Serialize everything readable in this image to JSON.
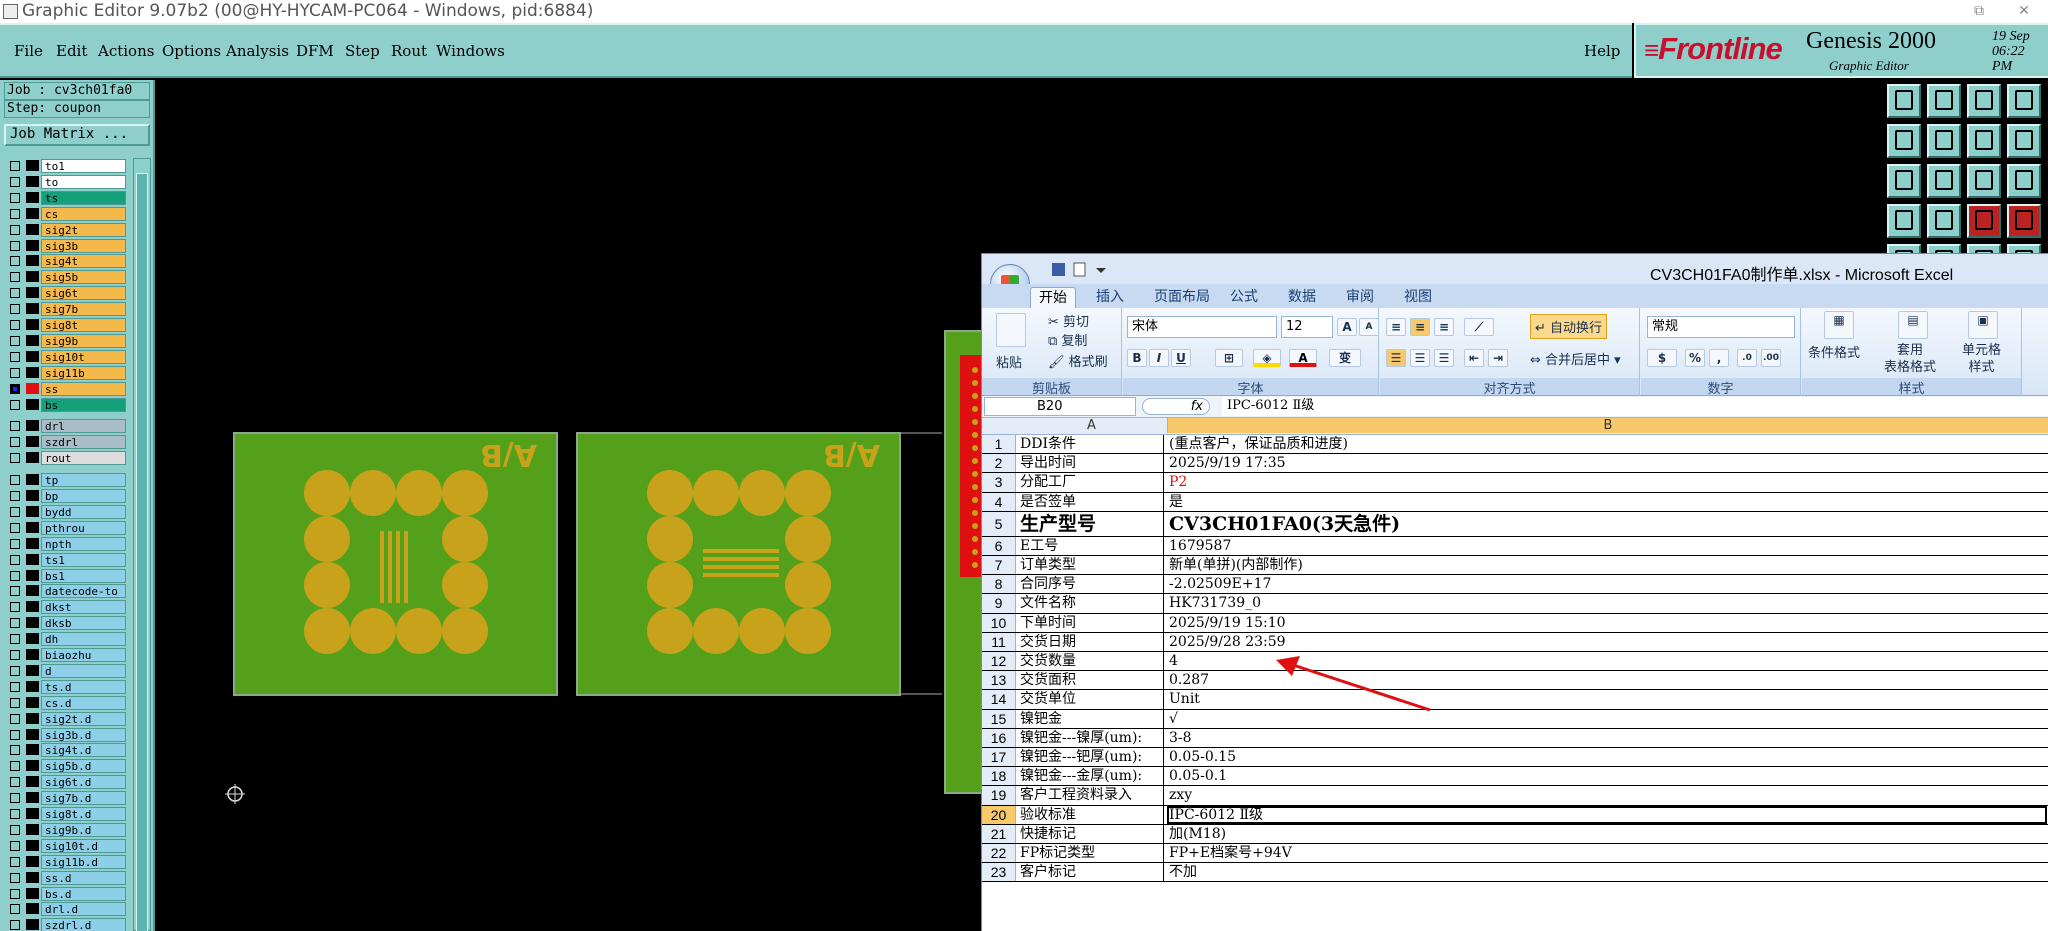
{
  "window": {
    "title": "Graphic Editor 9.07b2 (00@HY-HYCAM-PC064 - Windows, pid:6884)",
    "restore_glyph": "⧉",
    "close_glyph": "✕"
  },
  "menu": {
    "items": [
      "File",
      "Edit",
      "Actions",
      "Options",
      "Analysis",
      "DFM",
      "Step",
      "Rout",
      "Windows"
    ],
    "help": "Help"
  },
  "brand": {
    "logo": "Frontline",
    "product": "Genesis 2000",
    "subtitle": "Graphic Editor",
    "date": "19 Sep",
    "time": "06:22 PM"
  },
  "job": {
    "job_line": "Job : cv3ch01fa0",
    "step_line": "Step: coupon",
    "matrix_button": "Job Matrix ..."
  },
  "layers": [
    {
      "name": "to1",
      "color": "#ffffff",
      "checked": false
    },
    {
      "name": "to",
      "color": "#ffffff",
      "checked": false
    },
    {
      "name": "ts",
      "color": "#13a07a",
      "checked": false
    },
    {
      "name": "cs",
      "color": "#f5b84a",
      "checked": false
    },
    {
      "name": "sig2t",
      "color": "#f5b84a",
      "checked": false
    },
    {
      "name": "sig3b",
      "color": "#f5b84a",
      "checked": false
    },
    {
      "name": "sig4t",
      "color": "#f5b84a",
      "checked": false
    },
    {
      "name": "sig5b",
      "color": "#f5b84a",
      "checked": false
    },
    {
      "name": "sig6t",
      "color": "#f5b84a",
      "checked": false
    },
    {
      "name": "sig7b",
      "color": "#f5b84a",
      "checked": false
    },
    {
      "name": "sig8t",
      "color": "#f5b84a",
      "checked": false
    },
    {
      "name": "sig9b",
      "color": "#f5b84a",
      "checked": false
    },
    {
      "name": "sig10t",
      "color": "#f5b84a",
      "checked": false
    },
    {
      "name": "sig11b",
      "color": "#f5b84a",
      "checked": false
    },
    {
      "name": "ss",
      "color": "#f5b84a",
      "checked": true,
      "swatch": "#e01010"
    },
    {
      "name": "bs",
      "color": "#13a07a",
      "checked": false
    },
    {
      "name": "drl",
      "color": "#a8bdc8",
      "checked": false
    },
    {
      "name": "szdrl",
      "color": "#a8bdc8",
      "checked": false
    },
    {
      "name": "rout",
      "color": "#dddddd",
      "checked": false
    },
    {
      "name": "tp",
      "color": "#8ecfe8",
      "checked": false
    },
    {
      "name": "bp",
      "color": "#8ecfe8",
      "checked": false
    },
    {
      "name": "bydd",
      "color": "#8ecfe8",
      "checked": false
    },
    {
      "name": "pthrou",
      "color": "#8ecfe8",
      "checked": false
    },
    {
      "name": "npth",
      "color": "#8ecfe8",
      "checked": false
    },
    {
      "name": "ts1",
      "color": "#8ecfe8",
      "checked": false
    },
    {
      "name": "bs1",
      "color": "#8ecfe8",
      "checked": false
    },
    {
      "name": "datecode-to",
      "color": "#8ecfe8",
      "checked": false
    },
    {
      "name": "dkst",
      "color": "#8ecfe8",
      "checked": false
    },
    {
      "name": "dksb",
      "color": "#8ecfe8",
      "checked": false
    },
    {
      "name": "dh",
      "color": "#8ecfe8",
      "checked": false
    },
    {
      "name": "biaozhu",
      "color": "#8ecfe8",
      "checked": false
    },
    {
      "name": "d",
      "color": "#8ecfe8",
      "checked": false
    },
    {
      "name": "ts.d",
      "color": "#8ecfe8",
      "checked": false
    },
    {
      "name": "cs.d",
      "color": "#8ecfe8",
      "checked": false
    },
    {
      "name": "sig2t.d",
      "color": "#8ecfe8",
      "checked": false
    },
    {
      "name": "sig3b.d",
      "color": "#8ecfe8",
      "checked": false
    },
    {
      "name": "sig4t.d",
      "color": "#8ecfe8",
      "checked": false
    },
    {
      "name": "sig5b.d",
      "color": "#8ecfe8",
      "checked": false
    },
    {
      "name": "sig6t.d",
      "color": "#8ecfe8",
      "checked": false
    },
    {
      "name": "sig7b.d",
      "color": "#8ecfe8",
      "checked": false
    },
    {
      "name": "sig8t.d",
      "color": "#8ecfe8",
      "checked": false
    },
    {
      "name": "sig9b.d",
      "color": "#8ecfe8",
      "checked": false
    },
    {
      "name": "sig10t.d",
      "color": "#8ecfe8",
      "checked": false
    },
    {
      "name": "sig11b.d",
      "color": "#8ecfe8",
      "checked": false
    },
    {
      "name": "ss.d",
      "color": "#8ecfe8",
      "checked": false
    },
    {
      "name": "bs.d",
      "color": "#8ecfe8",
      "checked": false
    },
    {
      "name": "drl.d",
      "color": "#8ecfe8",
      "checked": false
    },
    {
      "name": "szdrl.d",
      "color": "#8ecfe8",
      "checked": false
    }
  ],
  "canvas": {
    "board_marking": "A/B",
    "board_color": "#55a01a",
    "pad_color": "#c9a21c"
  },
  "excel": {
    "title": "CV3CH01FA0制作单.xlsx - Microsoft Excel",
    "tabs": [
      "开始",
      "插入",
      "页面布局",
      "公式",
      "数据",
      "审阅",
      "视图"
    ],
    "clipboard": {
      "paste": "粘贴",
      "cut": "剪切",
      "copy": "复制",
      "format_painter": "格式刷",
      "label": "剪贴板"
    },
    "font": {
      "name": "宋体",
      "size": "12",
      "label": "字体",
      "bold": "B",
      "italic": "I",
      "underline": "U",
      "grow": "A",
      "shrink": "A"
    },
    "alignment": {
      "wrap": "自动换行",
      "merge": "合并后居中",
      "label": "对齐方式"
    },
    "number": {
      "format": "常规",
      "percent": "%",
      "comma": ",",
      "label": "数字"
    },
    "styles": {
      "conditional": "条件格式",
      "table": "套用\n表格格式",
      "cell": "单元格\n样式",
      "label": "样式"
    },
    "name_box": "B20",
    "fx": "fx",
    "formula": "IPC-6012 Ⅱ级",
    "columns": [
      "A",
      "B"
    ],
    "rows": [
      {
        "n": "1",
        "a": "DDI条件",
        "b": "(重点客户，保证品质和进度)"
      },
      {
        "n": "2",
        "a": "导出时间",
        "b": "2025/9/19 17:35"
      },
      {
        "n": "3",
        "a": "分配工厂",
        "b": "P2",
        "red": true
      },
      {
        "n": "4",
        "a": "是否签单",
        "b": "是"
      },
      {
        "n": "5",
        "a": "生产型号",
        "b": "CV3CH01FA0(3天急件)",
        "big": true
      },
      {
        "n": "6",
        "a": "E工号",
        "b": "1679587"
      },
      {
        "n": "7",
        "a": "订单类型",
        "b": "新单(单拼)(内部制作)"
      },
      {
        "n": "8",
        "a": "合同序号",
        "b": "-2.02509E+17"
      },
      {
        "n": "9",
        "a": "文件名称",
        "b": "HK731739_0"
      },
      {
        "n": "10",
        "a": "下单时间",
        "b": "2025/9/19 15:10"
      },
      {
        "n": "11",
        "a": "交货日期",
        "b": "2025/9/28 23:59"
      },
      {
        "n": "12",
        "a": "交货数量",
        "b": "4"
      },
      {
        "n": "13",
        "a": "交货面积",
        "b": "0.287"
      },
      {
        "n": "14",
        "a": "交货单位",
        "b": "Unit"
      },
      {
        "n": "15",
        "a": "镍钯金",
        "b": "√"
      },
      {
        "n": "16",
        "a": "镍钯金---镍厚(um):",
        "b": "3-8"
      },
      {
        "n": "17",
        "a": "镍钯金---钯厚(um):",
        "b": "0.05-0.15"
      },
      {
        "n": "18",
        "a": "镍钯金---金厚(um):",
        "b": "0.05-0.1"
      },
      {
        "n": "19",
        "a": "客户工程资料录入",
        "b": "zxy"
      },
      {
        "n": "20",
        "a": "验收标准",
        "b": "IPC-6012 Ⅱ级",
        "selected": true
      },
      {
        "n": "21",
        "a": "快捷标记",
        "b": "加(M18)"
      },
      {
        "n": "22",
        "a": "FP标记类型",
        "b": "FP+E档案号+94V"
      },
      {
        "n": "23",
        "a": "客户标记",
        "b": "不加"
      }
    ]
  }
}
